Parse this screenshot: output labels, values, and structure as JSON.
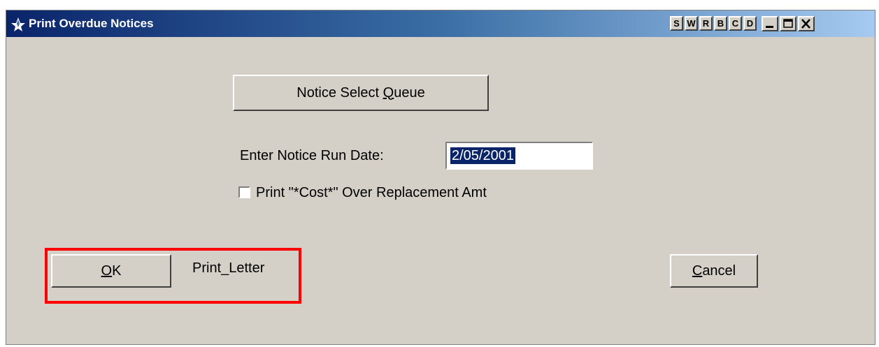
{
  "window": {
    "title": "Print Overdue Notices",
    "icon": "app-star-icon",
    "toolbar_buttons": [
      "S",
      "W",
      "R",
      "B",
      "C",
      "D"
    ],
    "controls": {
      "minimize": "minimize-icon",
      "maximize": "maximize-icon",
      "close": "close-icon"
    }
  },
  "form": {
    "notice_queue_button": {
      "before": "Notice Select ",
      "mnemonic": "Q",
      "after": "ueue"
    },
    "run_date_label": "Enter Notice Run Date:",
    "run_date_value": "2/05/2001",
    "cost_checkbox": {
      "label": "Print \"*Cost*\" Over Replacement Amt",
      "checked": false
    },
    "ok_button": {
      "mnemonic": "O",
      "after": "K"
    },
    "print_letter_label": "Print_Letter",
    "cancel_button": {
      "mnemonic": "C",
      "after": "ancel"
    }
  },
  "colors": {
    "title_start": "#0a246a",
    "title_end": "#a6caf0",
    "face": "#d4d0c8",
    "highlight_box": "#ff0000",
    "selection": "#0a246a"
  }
}
